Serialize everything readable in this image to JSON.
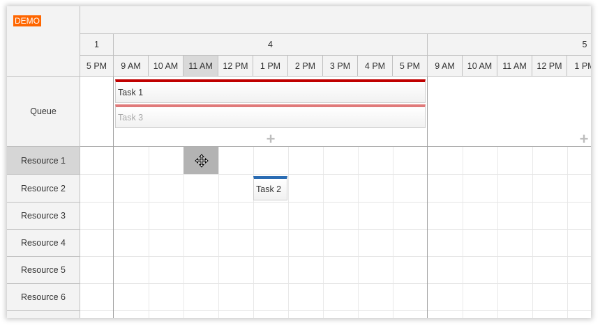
{
  "demo_badge": "DEMO",
  "days": [
    "1",
    "4",
    "5"
  ],
  "hours": [
    "5 PM",
    "9 AM",
    "10 AM",
    "11 AM",
    "12 PM",
    "1 PM",
    "2 PM",
    "3 PM",
    "4 PM",
    "5 PM",
    "9 AM",
    "10 AM",
    "11 AM",
    "12 PM",
    "1 PM"
  ],
  "queue_label": "Queue",
  "resources": [
    "Resource 1",
    "Resource 2",
    "Resource 3",
    "Resource 4",
    "Resource 5",
    "Resource 6"
  ],
  "tasks": {
    "task1": "Task 1",
    "task2": "Task 2",
    "task3": "Task 3"
  },
  "colors": {
    "task1_bar": "#c00000",
    "task2_bar": "#2a6cb3",
    "task3_bar": "#e07a7a",
    "demo_badge": "#ff6600"
  },
  "icons": {
    "add": "plus-icon",
    "move": "move-cursor-icon"
  }
}
